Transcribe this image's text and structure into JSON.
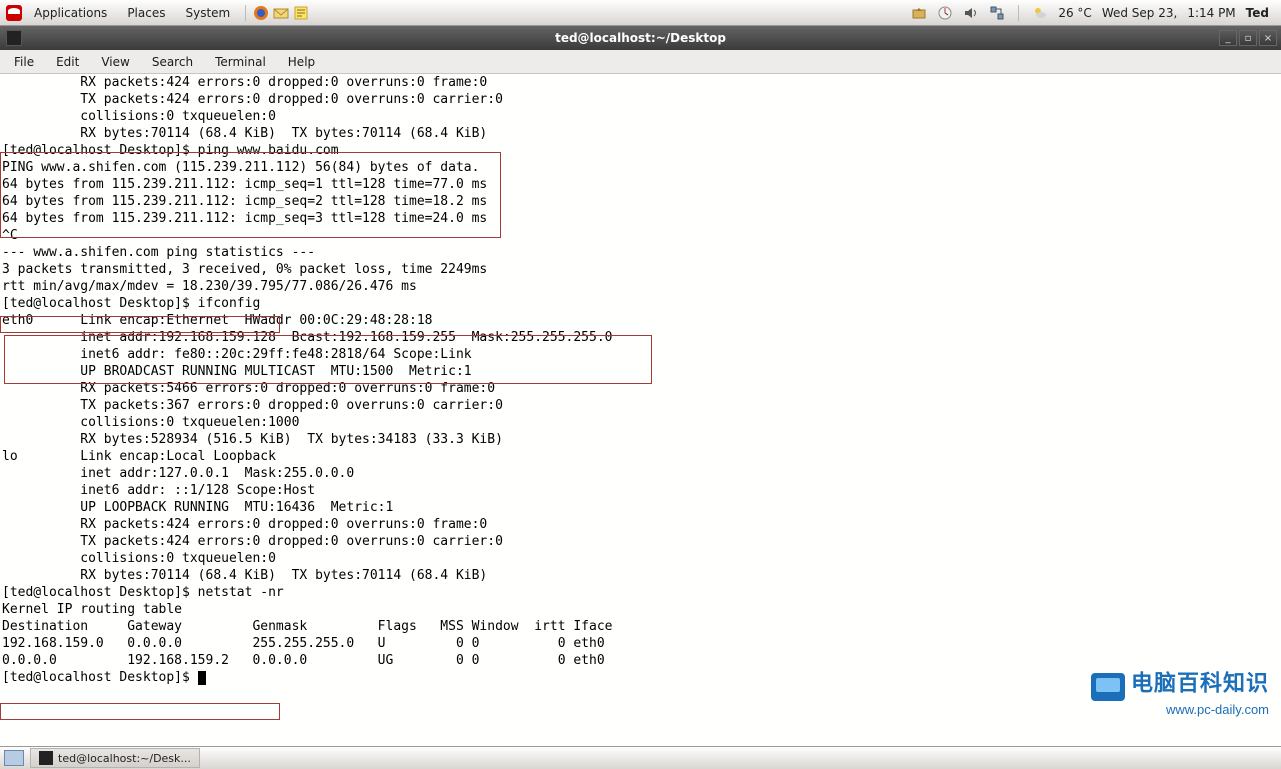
{
  "toppanel": {
    "menu_applications": "Applications",
    "menu_places": "Places",
    "menu_system": "System",
    "weather": "26 °C",
    "date": "Wed Sep 23,",
    "time": "1:14 PM",
    "user": "Ted"
  },
  "window": {
    "title": "ted@localhost:~/Desktop",
    "min": "_",
    "max": "▫",
    "close": "×"
  },
  "menubar": {
    "file": "File",
    "edit": "Edit",
    "view": "View",
    "search": "Search",
    "terminal": "Terminal",
    "help": "Help"
  },
  "terminal": {
    "l01": "          RX packets:424 errors:0 dropped:0 overruns:0 frame:0",
    "l02": "          TX packets:424 errors:0 dropped:0 overruns:0 carrier:0",
    "l03": "          collisions:0 txqueuelen:0 ",
    "l04": "          RX bytes:70114 (68.4 KiB)  TX bytes:70114 (68.4 KiB)",
    "l05": "",
    "l06": "[ted@localhost Desktop]$ ping www.baidu.com",
    "l07": "PING www.a.shifen.com (115.239.211.112) 56(84) bytes of data.",
    "l08": "64 bytes from 115.239.211.112: icmp_seq=1 ttl=128 time=77.0 ms",
    "l09": "64 bytes from 115.239.211.112: icmp_seq=2 ttl=128 time=18.2 ms",
    "l10": "64 bytes from 115.239.211.112: icmp_seq=3 ttl=128 time=24.0 ms",
    "l11": "^C",
    "l12": "--- www.a.shifen.com ping statistics ---",
    "l13": "3 packets transmitted, 3 received, 0% packet loss, time 2249ms",
    "l14": "rtt min/avg/max/mdev = 18.230/39.795/77.086/26.476 ms",
    "l15": "[ted@localhost Desktop]$ ifconfig",
    "l16": "eth0      Link encap:Ethernet  HWaddr 00:0C:29:48:28:18  ",
    "l17": "          inet addr:192.168.159.128  Bcast:192.168.159.255  Mask:255.255.255.0",
    "l18": "          inet6 addr: fe80::20c:29ff:fe48:2818/64 Scope:Link",
    "l19": "          UP BROADCAST RUNNING MULTICAST  MTU:1500  Metric:1",
    "l20": "          RX packets:5466 errors:0 dropped:0 overruns:0 frame:0",
    "l21": "          TX packets:367 errors:0 dropped:0 overruns:0 carrier:0",
    "l22": "          collisions:0 txqueuelen:1000 ",
    "l23": "          RX bytes:528934 (516.5 KiB)  TX bytes:34183 (33.3 KiB)",
    "l24": "",
    "l25": "lo        Link encap:Local Loopback  ",
    "l26": "          inet addr:127.0.0.1  Mask:255.0.0.0",
    "l27": "          inet6 addr: ::1/128 Scope:Host",
    "l28": "          UP LOOPBACK RUNNING  MTU:16436  Metric:1",
    "l29": "          RX packets:424 errors:0 dropped:0 overruns:0 frame:0",
    "l30": "          TX packets:424 errors:0 dropped:0 overruns:0 carrier:0",
    "l31": "          collisions:0 txqueuelen:0 ",
    "l32": "          RX bytes:70114 (68.4 KiB)  TX bytes:70114 (68.4 KiB)",
    "l33": "",
    "l34": "[ted@localhost Desktop]$ netstat -nr",
    "l35": "Kernel IP routing table",
    "l36": "Destination     Gateway         Genmask         Flags   MSS Window  irtt Iface",
    "l37": "192.168.159.0   0.0.0.0         255.255.255.0   U         0 0          0 eth0",
    "l38": "0.0.0.0         192.168.159.2   0.0.0.0         UG        0 0          0 eth0",
    "l39": "[ted@localhost Desktop]$ "
  },
  "bottompanel": {
    "task": "ted@localhost:~/Desk..."
  },
  "watermark": {
    "line1": "电脑百科知识",
    "line2": "www.pc-daily.com"
  }
}
